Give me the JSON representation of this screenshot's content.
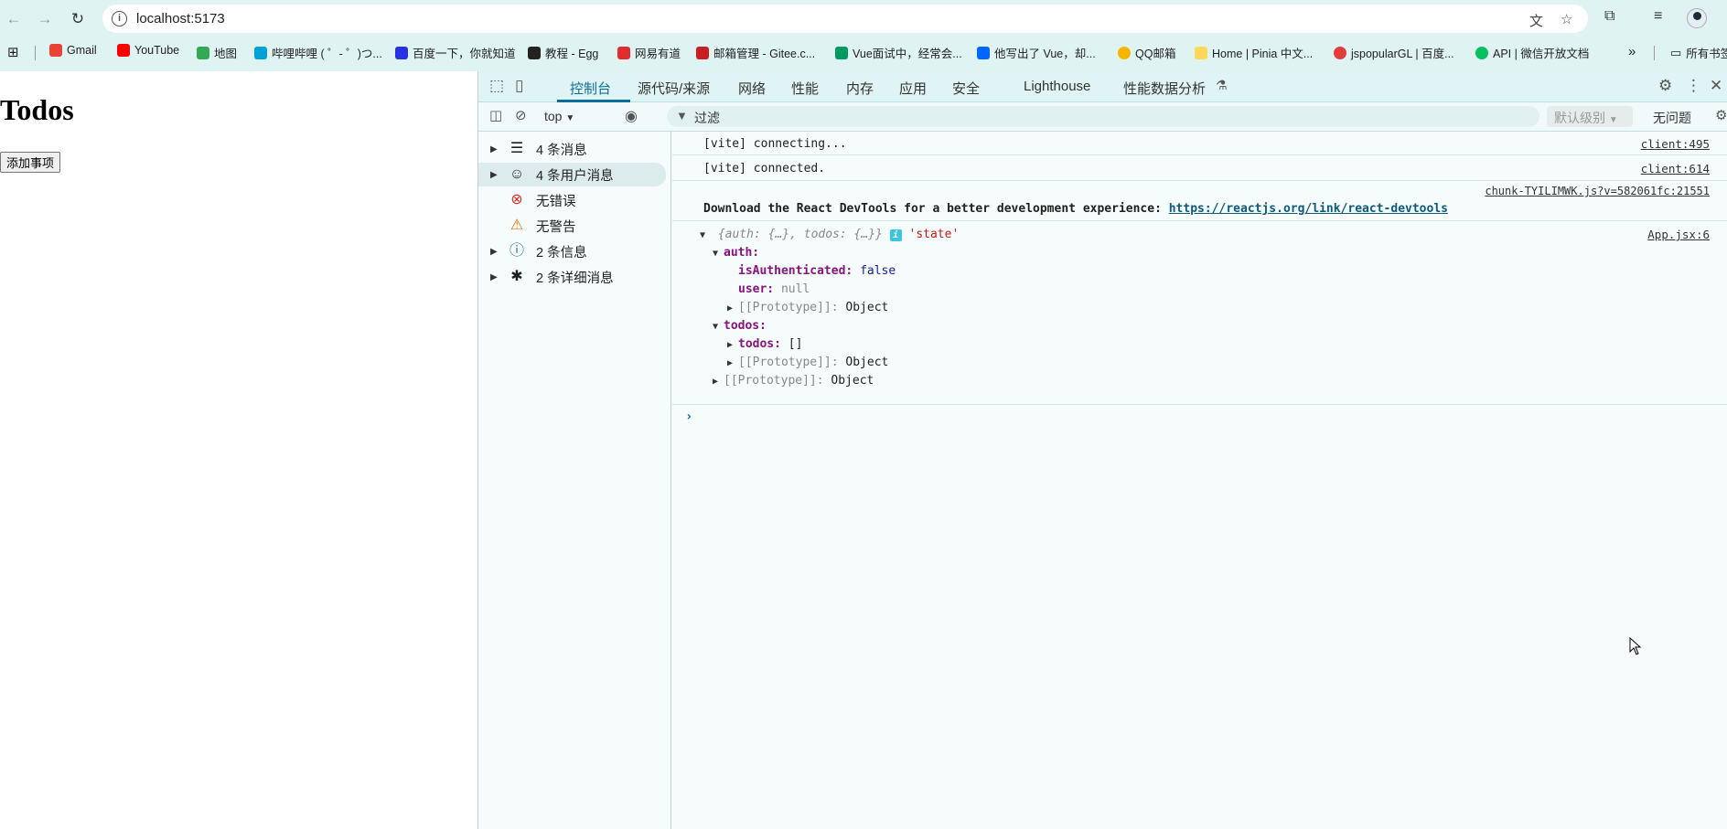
{
  "browser": {
    "url": "localhost:5173",
    "bookmarks": [
      {
        "label": "Gmail",
        "color": "#ea4335"
      },
      {
        "label": "YouTube",
        "color": "#ff0000"
      },
      {
        "label": "地图",
        "color": "#34a853"
      },
      {
        "label": "哔哩哔哩 ( ゜- ゜)つ...",
        "color": "#00a1d6"
      },
      {
        "label": "百度一下，你就知道",
        "color": "#2932e1"
      },
      {
        "label": "教程 - Egg",
        "color": "#222222"
      },
      {
        "label": "网易有道",
        "color": "#e12d2d"
      },
      {
        "label": "邮箱管理 - Gitee.c...",
        "color": "#c71d23"
      },
      {
        "label": "Vue面试中，经常会...",
        "color": "#009a61"
      },
      {
        "label": "他写出了 Vue，却...",
        "color": "#0066ff"
      },
      {
        "label": "QQ邮箱",
        "color": "#f7b500"
      },
      {
        "label": "Home | Pinia 中文...",
        "color": "#ffd859"
      },
      {
        "label": "jspopularGL | 百度...",
        "color": "#e23c3c"
      },
      {
        "label": "API | 微信开放文档",
        "color": "#07c160"
      }
    ],
    "bookmarks_overflow": "»",
    "all_bookmarks": "所有书签"
  },
  "page": {
    "heading": "Todos",
    "add_button": "添加事项"
  },
  "devtools": {
    "tabs": [
      "控制台",
      "源代码/来源",
      "网络",
      "性能",
      "内存",
      "应用",
      "安全",
      "Lighthouse",
      "性能数据分析"
    ],
    "context": "top",
    "filter_placeholder": "过滤",
    "level": "默认级别",
    "issues": "无问题",
    "sidebar": [
      {
        "label": "4 条消息",
        "icon": "list-icon",
        "expandable": true
      },
      {
        "label": "4 条用户消息",
        "icon": "user-icon",
        "expandable": true
      },
      {
        "label": "无错误",
        "icon": "error-icon",
        "expandable": false
      },
      {
        "label": "无警告",
        "icon": "warning-icon",
        "expandable": false
      },
      {
        "label": "2 条信息",
        "icon": "info-icon",
        "expandable": true
      },
      {
        "label": "2 条详细消息",
        "icon": "bug-icon",
        "expandable": true
      }
    ],
    "console": {
      "line1": {
        "msg": "[vite] connecting...",
        "src": "client:495"
      },
      "line2": {
        "msg": "[vite] connected.",
        "src": "client:614"
      },
      "line3": {
        "src": "chunk-TYILIMWK.js?v=582061fc:21551",
        "msg": "Download the React DevTools for a better development experience: ",
        "link": "https://reactjs.org/link/react-devtools"
      },
      "state": {
        "summary": "{auth: {…}, todos: {…}}",
        "label": "'state'",
        "src": "App.jsx:6",
        "auth_key": "auth:",
        "is_auth_key": "isAuthenticated:",
        "is_auth_val": "false",
        "user_key": "user:",
        "user_val": "null",
        "proto_key": "[[Prototype]]:",
        "proto_val": "Object",
        "todos_key": "todos:",
        "todos_inner_key": "todos:",
        "todos_inner_val": "[]"
      }
    }
  }
}
